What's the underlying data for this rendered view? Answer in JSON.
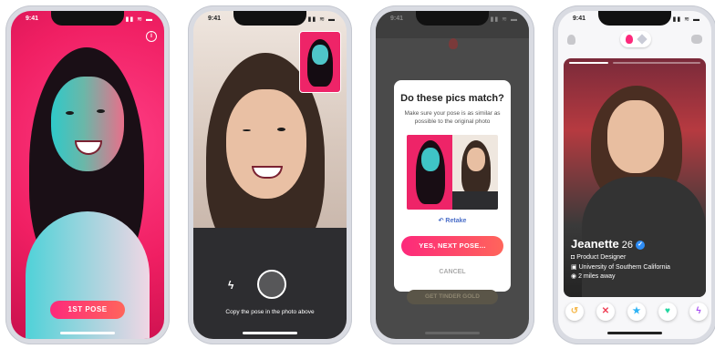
{
  "status": {
    "time": "9:41",
    "icons": "▮▮ ≋ ▬"
  },
  "phone1": {
    "button_label": "1ST POSE",
    "info_symbol": "i"
  },
  "phone2": {
    "instruction": "Copy the pose in the photo above",
    "flash_symbol": "ϟ"
  },
  "phone3": {
    "title": "Do these pics match?",
    "subtitle": "Make sure your pose is as similar as possible to the original photo",
    "retake_label": "Retake",
    "retake_symbol": "↶",
    "confirm_label": "YES, NEXT POSE...",
    "cancel_label": "CANCEL",
    "background_button": "GET TINDER GOLD"
  },
  "phone4": {
    "name": "Jeanette",
    "age": "26",
    "verified_symbol": "✓",
    "job": "Product Designer",
    "school": "University of Southern California",
    "distance": "2 miles away",
    "actions": [
      {
        "name": "rewind",
        "symbol": "↺",
        "color": "#f5b748"
      },
      {
        "name": "nope",
        "symbol": "✕",
        "color": "#ef3e55"
      },
      {
        "name": "super-like",
        "symbol": "★",
        "color": "#2db3f5"
      },
      {
        "name": "like",
        "symbol": "♥",
        "color": "#21d6a0"
      },
      {
        "name": "boost",
        "symbol": "ϟ",
        "color": "#a64df0"
      }
    ]
  },
  "colors": {
    "brand_pink": "#fd297b",
    "brand_orange": "#ff655b",
    "link_blue": "#4a6ec8"
  }
}
